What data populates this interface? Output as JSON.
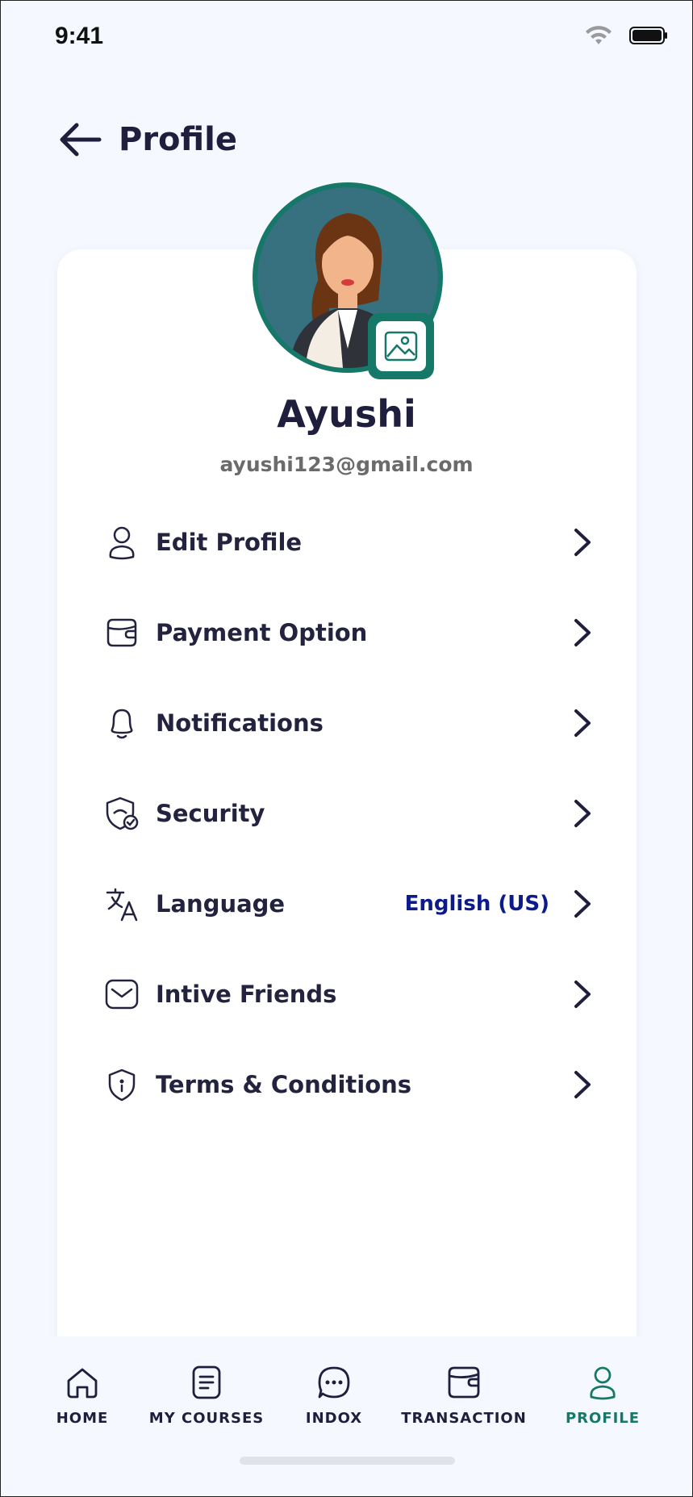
{
  "status_bar": {
    "time": "9:41"
  },
  "header": {
    "title": "Profile"
  },
  "profile": {
    "name": "Ayushi",
    "email": "ayushi123@gmail.com"
  },
  "menu": [
    {
      "label": "Edit Profile",
      "icon": "user-icon",
      "value": ""
    },
    {
      "label": "Payment Option",
      "icon": "wallet-icon",
      "value": ""
    },
    {
      "label": "Notifications",
      "icon": "bell-icon",
      "value": ""
    },
    {
      "label": "Security",
      "icon": "shield-check-icon",
      "value": ""
    },
    {
      "label": "Language",
      "icon": "translate-icon",
      "value": "English (US)"
    },
    {
      "label": "Intive Friends",
      "icon": "mail-icon",
      "value": ""
    },
    {
      "label": "Terms & Conditions",
      "icon": "shield-info-icon",
      "value": ""
    }
  ],
  "bottom_nav": [
    {
      "label": "HOME",
      "icon": "home-icon",
      "active": false
    },
    {
      "label": "MY COURSES",
      "icon": "courses-icon",
      "active": false
    },
    {
      "label": "INDOX",
      "icon": "chat-icon",
      "active": false
    },
    {
      "label": "TRANSACTION",
      "icon": "wallet-icon",
      "active": false
    },
    {
      "label": "PROFILE",
      "icon": "user-icon",
      "active": true
    }
  ],
  "colors": {
    "accent": "#167868",
    "text": "#1f1f3d",
    "value_text": "#0d1a8a",
    "background": "#f5f9ff"
  }
}
